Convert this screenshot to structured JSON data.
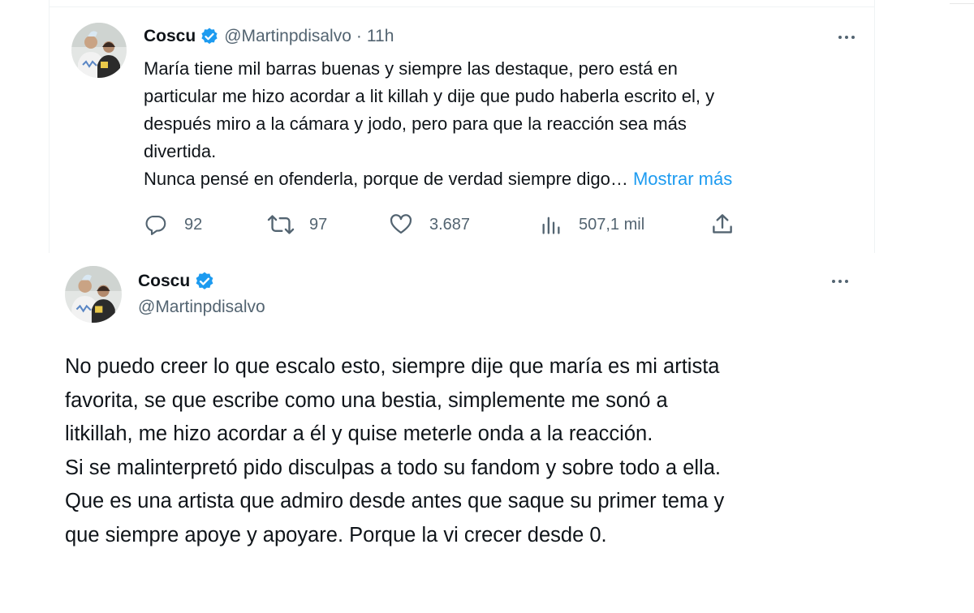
{
  "colors": {
    "accent": "#1d9bf0",
    "muted": "#536471",
    "text": "#0f1419"
  },
  "tweet1": {
    "avatar_icon": "profile-photo",
    "name": "Coscu",
    "verified_icon": "verified-badge-icon",
    "handle": "@Martinpdisalvo",
    "separator": "·",
    "time": "11h",
    "more_icon": "more-dots-icon",
    "lines": [
      "María tiene mil barras buenas y siempre las destaque, pero está en",
      "particular me hizo acordar a lit killah y dije que pudo haberla escrito el, y",
      "después miro a la cámara y jodo, pero para que la reacción sea más",
      "divertida."
    ],
    "last_line": "Nunca pensé en ofenderla, porque de verdad siempre digo…",
    "show_more": "Mostrar más",
    "actions": {
      "reply": {
        "icon": "reply-icon",
        "count": "92"
      },
      "retweet": {
        "icon": "retweet-icon",
        "count": "97"
      },
      "like": {
        "icon": "heart-icon",
        "count": "3.687"
      },
      "views": {
        "icon": "views-chart-icon",
        "count": "507,1 mil"
      },
      "share": {
        "icon": "share-icon"
      }
    }
  },
  "tweet2": {
    "avatar_icon": "profile-photo",
    "name": "Coscu",
    "verified_icon": "verified-badge-icon",
    "handle": "@Martinpdisalvo",
    "more_icon": "more-dots-icon",
    "lines": [
      "No puedo creer lo que escalo esto, siempre dije que maría es mi artista",
      "favorita, se que escribe como una bestia, simplemente me sonó a",
      "litkillah, me hizo acordar a él y quise meterle onda a la reacción.",
      "Si se malinterpretó pido disculpas a todo su fandom y sobre todo a ella.",
      "Que es una artista que admiro desde antes que saque su primer tema y",
      "que siempre apoye y apoyare. Porque la vi crecer desde 0."
    ]
  }
}
